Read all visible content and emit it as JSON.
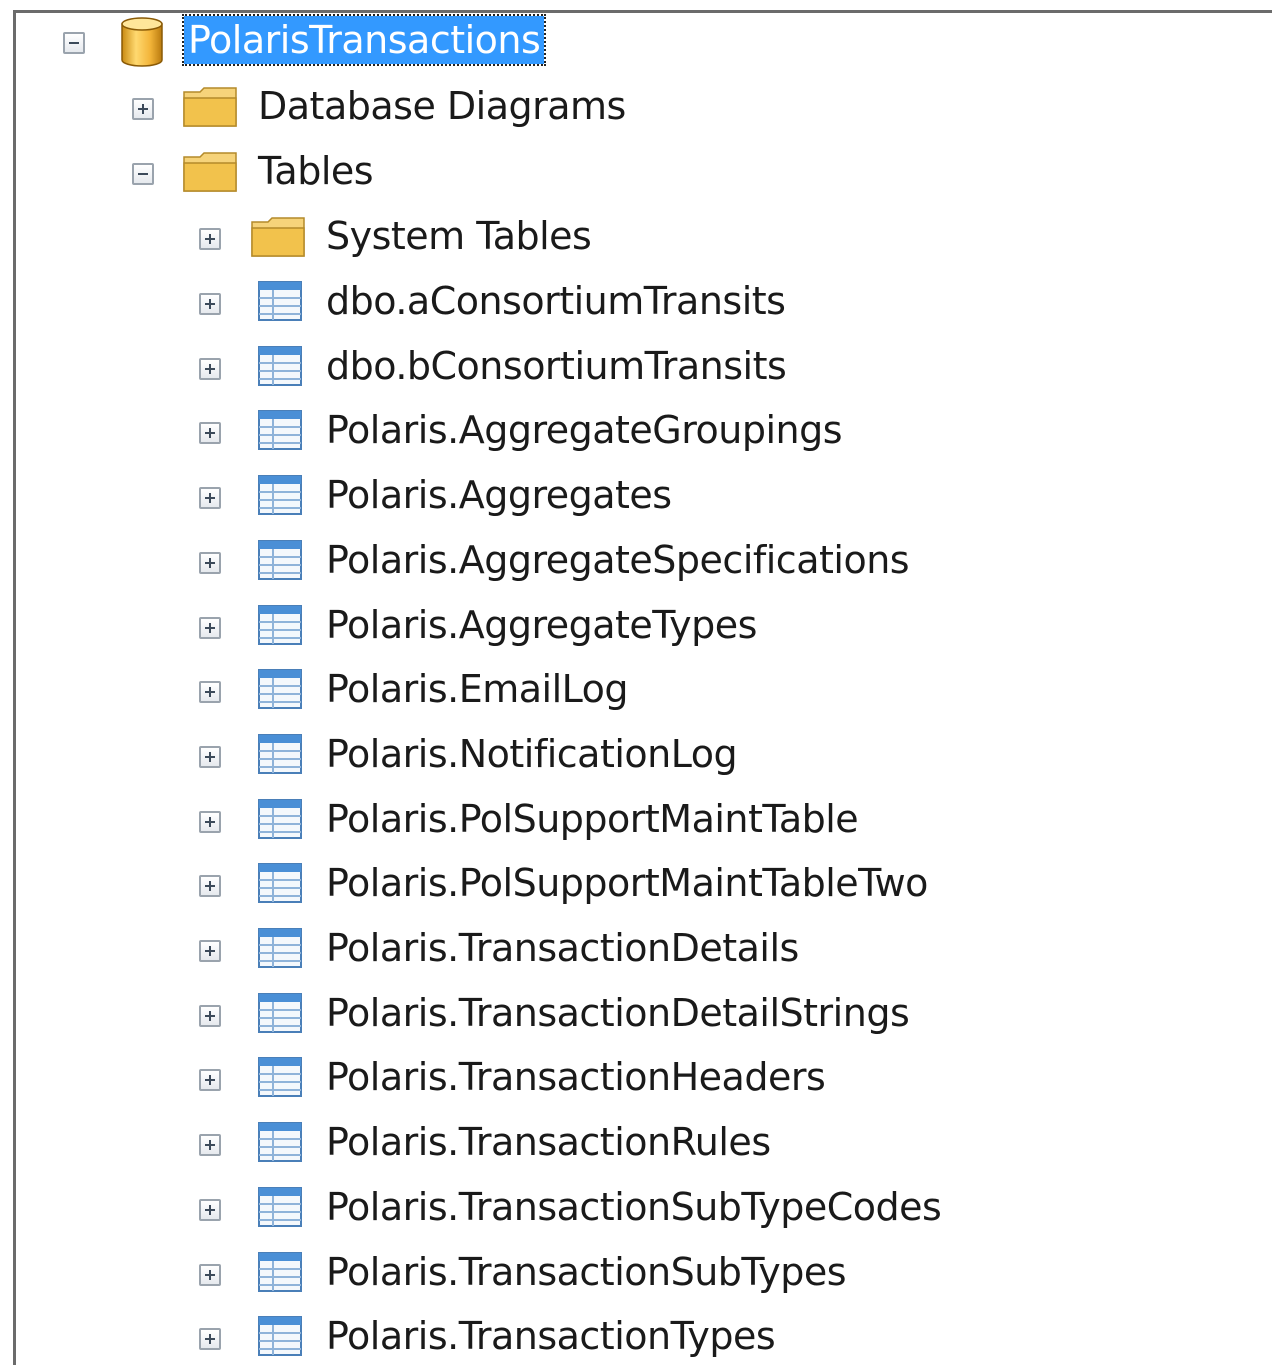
{
  "root": {
    "label": "PolarisTransactions",
    "icon": "database-icon",
    "expanded": true,
    "selected": true
  },
  "database_diagrams": {
    "label": "Database Diagrams",
    "icon": "folder-icon",
    "expanded": false
  },
  "tables": {
    "label": "Tables",
    "icon": "folder-icon",
    "expanded": true,
    "system_tables": {
      "label": "System Tables",
      "icon": "folder-icon",
      "expanded": false
    },
    "items": [
      {
        "label": "dbo.aConsortiumTransits",
        "icon": "table-icon"
      },
      {
        "label": "dbo.bConsortiumTransits",
        "icon": "table-icon"
      },
      {
        "label": "Polaris.AggregateGroupings",
        "icon": "table-icon"
      },
      {
        "label": "Polaris.Aggregates",
        "icon": "table-icon"
      },
      {
        "label": "Polaris.AggregateSpecifications",
        "icon": "table-icon"
      },
      {
        "label": "Polaris.AggregateTypes",
        "icon": "table-icon"
      },
      {
        "label": "Polaris.EmailLog",
        "icon": "table-icon"
      },
      {
        "label": "Polaris.NotificationLog",
        "icon": "table-icon"
      },
      {
        "label": "Polaris.PolSupportMaintTable",
        "icon": "table-icon"
      },
      {
        "label": "Polaris.PolSupportMaintTableTwo",
        "icon": "table-icon"
      },
      {
        "label": "Polaris.TransactionDetails",
        "icon": "table-icon"
      },
      {
        "label": "Polaris.TransactionDetailStrings",
        "icon": "table-icon"
      },
      {
        "label": "Polaris.TransactionHeaders",
        "icon": "table-icon"
      },
      {
        "label": "Polaris.TransactionRules",
        "icon": "table-icon"
      },
      {
        "label": "Polaris.TransactionSubTypeCodes",
        "icon": "table-icon"
      },
      {
        "label": "Polaris.TransactionSubTypes",
        "icon": "table-icon"
      },
      {
        "label": "Polaris.TransactionTypes",
        "icon": "table-icon"
      }
    ]
  },
  "colors": {
    "selection": "#3399ff",
    "folder": "#f2c94c",
    "table_header": "#4a8fd6"
  }
}
